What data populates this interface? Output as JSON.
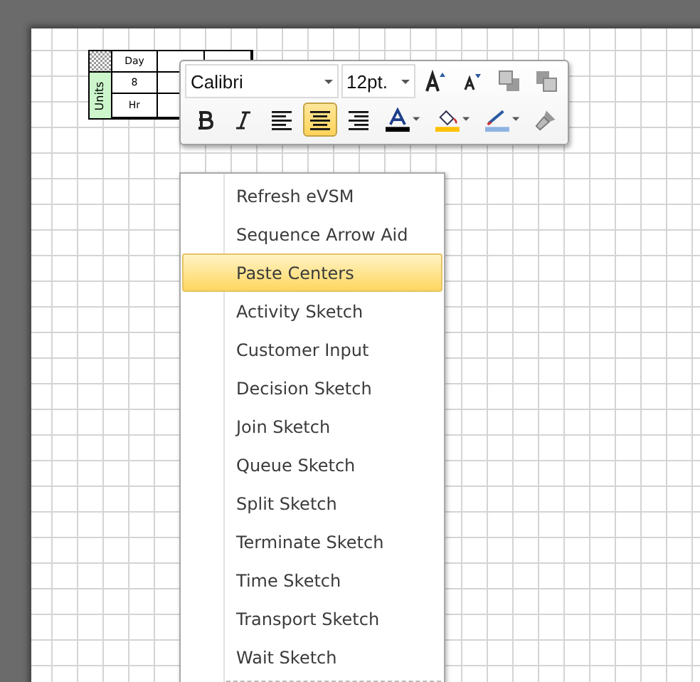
{
  "table": {
    "corner_label": "Units",
    "rows": [
      [
        "Day",
        "",
        ""
      ],
      [
        "8",
        "",
        ""
      ],
      [
        "Hr",
        "",
        ""
      ]
    ]
  },
  "mini_toolbar": {
    "font": "Calibri",
    "size": "12pt.",
    "top_buttons": [
      {
        "kind": "grow"
      },
      {
        "kind": "shrink"
      },
      {
        "kind": "front"
      },
      {
        "kind": "back"
      }
    ],
    "format_buttons": [
      {
        "kind": "bold",
        "selected": false
      },
      {
        "kind": "italic",
        "selected": false
      },
      {
        "kind": "left",
        "selected": false
      },
      {
        "kind": "center",
        "selected": true
      },
      {
        "kind": "right",
        "selected": false
      },
      {
        "kind": "fontcolor",
        "selected": false,
        "color": "#000000"
      },
      {
        "kind": "fill",
        "selected": false,
        "color": "#ffc000"
      },
      {
        "kind": "line",
        "selected": false,
        "color": "#8db3e2"
      },
      {
        "kind": "painter",
        "selected": false
      }
    ]
  },
  "context_menu": {
    "items": [
      {
        "label": "Refresh eVSM",
        "selected": false
      },
      {
        "label": "Sequence Arrow Aid",
        "selected": false
      },
      {
        "label": "Paste Centers",
        "selected": true
      },
      {
        "label": "Activity Sketch",
        "selected": false
      },
      {
        "label": "Customer Input",
        "selected": false
      },
      {
        "label": "Decision Sketch",
        "selected": false
      },
      {
        "label": "Join Sketch",
        "selected": false
      },
      {
        "label": "Queue Sketch",
        "selected": false
      },
      {
        "label": "Split Sketch",
        "selected": false
      },
      {
        "label": "Terminate Sketch",
        "selected": false
      },
      {
        "label": "Time Sketch",
        "selected": false
      },
      {
        "label": "Transport Sketch",
        "selected": false
      },
      {
        "label": "Wait Sketch",
        "selected": false
      }
    ]
  }
}
